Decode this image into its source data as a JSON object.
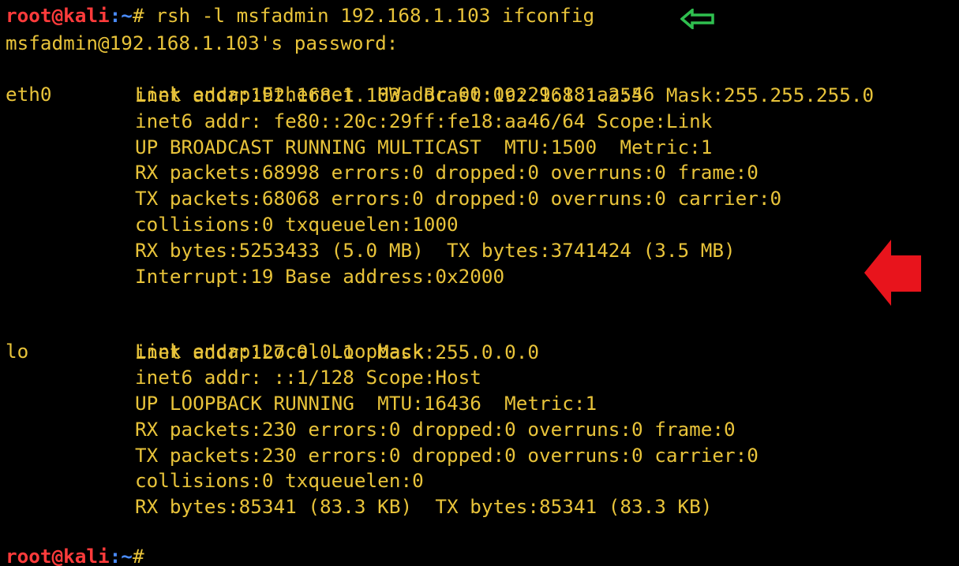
{
  "prompt": {
    "user": "root",
    "at": "@",
    "host": "kali",
    "path_sep": ":~",
    "symbol": "#"
  },
  "command": " rsh -l msfadmin 192.168.1.103 ifconfig",
  "password_prompt": "msfadmin@192.168.1.103's password:",
  "interfaces": [
    {
      "name": "eth0",
      "lines": [
        "Link encap:Ethernet  HWaddr 00:0c:29:18:aa:46",
        "inet addr:192.168.1.103  Bcast:192.168.1.255  Mask:255.255.255.0",
        "inet6 addr: fe80::20c:29ff:fe18:aa46/64 Scope:Link",
        "UP BROADCAST RUNNING MULTICAST  MTU:1500  Metric:1",
        "RX packets:68998 errors:0 dropped:0 overruns:0 frame:0",
        "TX packets:68068 errors:0 dropped:0 overruns:0 carrier:0",
        "collisions:0 txqueuelen:1000",
        "RX bytes:5253433 (5.0 MB)  TX bytes:3741424 (3.5 MB)",
        "Interrupt:19 Base address:0x2000"
      ]
    },
    {
      "name": "lo",
      "lines": [
        "Link encap:Local Loopback",
        "inet addr:127.0.0.1  Mask:255.0.0.0",
        "inet6 addr: ::1/128 Scope:Host",
        "UP LOOPBACK RUNNING  MTU:16436  Metric:1",
        "RX packets:230 errors:0 dropped:0 overruns:0 frame:0",
        "TX packets:230 errors:0 dropped:0 overruns:0 carrier:0",
        "collisions:0 txqueuelen:0",
        "RX bytes:85341 (83.3 KB)  TX bytes:85341 (83.3 KB)"
      ]
    }
  ],
  "annotations": {
    "command_arrow_icon": "left-arrow-outline-icon",
    "command_arrow_color": "#2fbf4f",
    "output_arrow_icon": "left-arrow-filled-icon",
    "output_arrow_color": "#e8141c"
  },
  "colors": {
    "background": "#000000",
    "text": "#e8c33a",
    "prompt_user_host": "#ff3b3b",
    "prompt_path": "#4a8cff"
  }
}
